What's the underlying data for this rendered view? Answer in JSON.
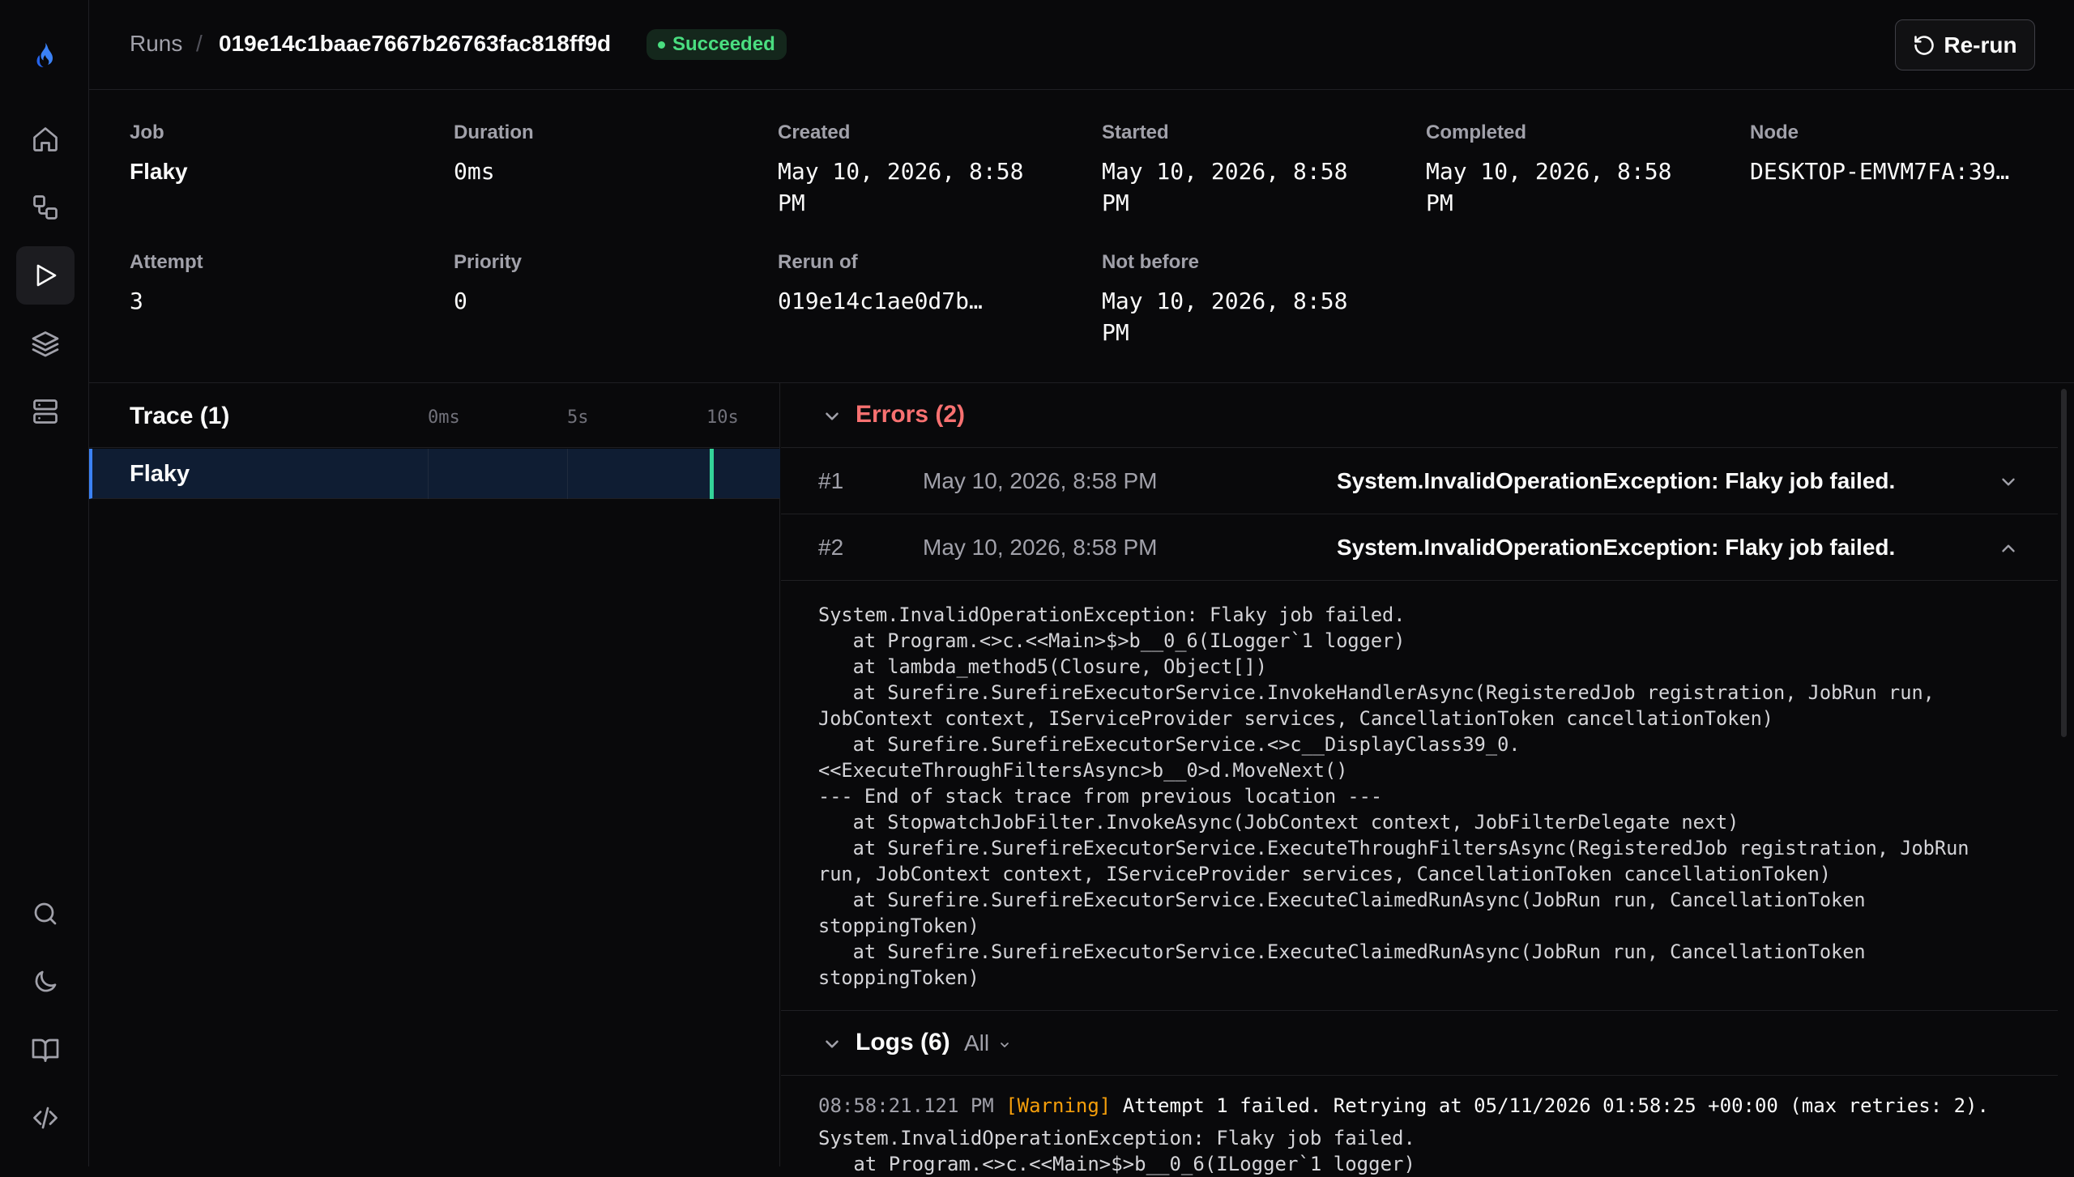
{
  "brand": {
    "accent": "#3b82f6",
    "success": "#4ade80",
    "error": "#f87171",
    "warning": "#f59e0b"
  },
  "sidebar": {
    "logo_icon": "flame-icon",
    "nav": [
      {
        "icon": "home-icon",
        "active": false
      },
      {
        "icon": "workflow-icon",
        "active": false
      },
      {
        "icon": "play-icon",
        "active": true
      },
      {
        "icon": "layers-icon",
        "active": false
      },
      {
        "icon": "server-icon",
        "active": false
      }
    ],
    "bottom": [
      {
        "icon": "search-icon"
      },
      {
        "icon": "moon-icon"
      },
      {
        "icon": "book-icon"
      },
      {
        "icon": "code-icon"
      }
    ]
  },
  "header": {
    "breadcrumb_root": "Runs",
    "separator": "/",
    "run_id": "019e14c1baae7667b26763fac818ff9d",
    "status": "Succeeded",
    "rerun_label": "Re-run"
  },
  "meta": {
    "job": {
      "label": "Job",
      "value": "Flaky"
    },
    "duration": {
      "label": "Duration",
      "value": "0ms"
    },
    "created": {
      "label": "Created",
      "value": "May 10, 2026, 8:58 PM"
    },
    "started": {
      "label": "Started",
      "value": "May 10, 2026, 8:58 PM"
    },
    "completed": {
      "label": "Completed",
      "value": "May 10, 2026, 8:58 PM"
    },
    "node": {
      "label": "Node",
      "value": "DESKTOP-EMVM7FA:39…"
    },
    "attempt": {
      "label": "Attempt",
      "value": "3"
    },
    "priority": {
      "label": "Priority",
      "value": "0"
    },
    "rerun_of": {
      "label": "Rerun of",
      "value": "019e14c1ae0d7b…"
    },
    "not_before": {
      "label": "Not before",
      "value": "May 10, 2026, 8:58 PM"
    }
  },
  "trace": {
    "title": "Trace (1)",
    "ticks": [
      "0ms",
      "5s",
      "10s"
    ],
    "rows": [
      {
        "name": "Flaky"
      }
    ]
  },
  "errors": {
    "title": "Errors (2)",
    "items": [
      {
        "num": "#1",
        "time": "May 10, 2026, 8:58 PM",
        "message": "System.InvalidOperationException: Flaky job failed.",
        "expanded": false
      },
      {
        "num": "#2",
        "time": "May 10, 2026, 8:58 PM",
        "message": "System.InvalidOperationException: Flaky job failed.",
        "expanded": true
      }
    ],
    "stack_trace": "System.InvalidOperationException: Flaky job failed.\n   at Program.<>c.<<Main>$>b__0_6(ILogger`1 logger)\n   at lambda_method5(Closure, Object[])\n   at Surefire.SurefireExecutorService.InvokeHandlerAsync(RegisteredJob registration, JobRun run, JobContext context, IServiceProvider services, CancellationToken cancellationToken)\n   at Surefire.SurefireExecutorService.<>c__DisplayClass39_0.<<ExecuteThroughFiltersAsync>b__0>d.MoveNext()\n--- End of stack trace from previous location ---\n   at StopwatchJobFilter.InvokeAsync(JobContext context, JobFilterDelegate next)\n   at Surefire.SurefireExecutorService.ExecuteThroughFiltersAsync(RegisteredJob registration, JobRun run, JobContext context, IServiceProvider services, CancellationToken cancellationToken)\n   at Surefire.SurefireExecutorService.ExecuteClaimedRunAsync(JobRun run, CancellationToken stoppingToken)\n   at Surefire.SurefireExecutorService.ExecuteClaimedRunAsync(JobRun run, CancellationToken stoppingToken)"
  },
  "logs": {
    "title": "Logs (6)",
    "filter": "All",
    "lines": [
      {
        "time": "08:58:21.121 PM",
        "level": "[Warning]",
        "message": "Attempt 1 failed. Retrying at 05/11/2026 01:58:25 +00:00 (max retries: 2)."
      }
    ],
    "continuation": [
      "System.InvalidOperationException: Flaky job failed.",
      "   at Program.<>c.<<Main>$>b__0_6(ILogger`1 logger)"
    ]
  }
}
